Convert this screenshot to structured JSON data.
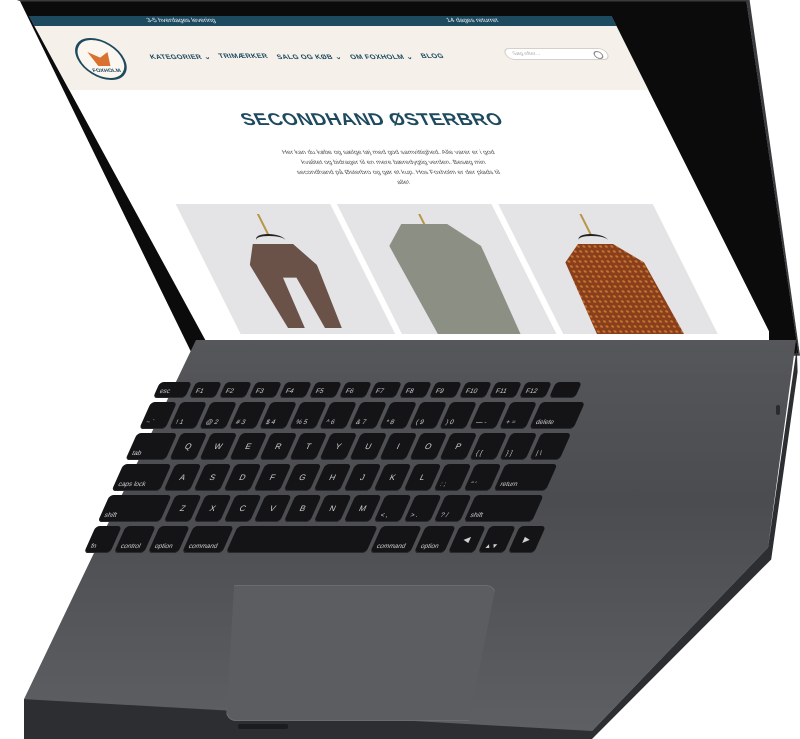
{
  "screen": {
    "topbar": {
      "left": "3-5 hverdages levering",
      "right": "14 dages returret"
    },
    "logo_text": "FOXHOLM",
    "nav": [
      "KATEGORIER ⌄",
      "TRIMÆRKER",
      "SALG OG KØB ⌄",
      "OM FOXHOLM ⌄",
      "BLOG"
    ],
    "search_placeholder": "Søg efter...",
    "title": "SECONDHAND ØSTERBRO",
    "intro": "Her kan du købe og sælge tøj med god samvittighed. Alle varer er i god kvalitet og bidrager til en mere bæredygtig verden. Besøg min secondhand på Østerbro og gør et kup. Hos Foxholm er der plads til alle!",
    "products": [
      "brown-cardigan",
      "grey-fur-coat",
      "patterned-dress"
    ]
  },
  "keyboard": {
    "fn_row": [
      "esc",
      "F1",
      "F2",
      "F3",
      "F4",
      "F5",
      "F6",
      "F7",
      "F8",
      "F9",
      "F10",
      "F11",
      "F12",
      ""
    ],
    "row1": [
      "~\n`",
      "!\n1",
      "@\n2",
      "#\n3",
      "$\n4",
      "%\n5",
      "^\n6",
      "&\n7",
      "*\n8",
      "(\n9",
      ")\n0",
      "—\n-",
      "+\n=",
      "delete"
    ],
    "row2": [
      "tab",
      "Q",
      "W",
      "E",
      "R",
      "T",
      "Y",
      "U",
      "I",
      "O",
      "P",
      "{\n[",
      "}\n]",
      "|\n\\"
    ],
    "row3": [
      "caps lock",
      "A",
      "S",
      "D",
      "F",
      "G",
      "H",
      "J",
      "K",
      "L",
      ":\n;",
      "\"\n'",
      "return"
    ],
    "row4": [
      "shift",
      "Z",
      "X",
      "C",
      "V",
      "B",
      "N",
      "M",
      "<\n,",
      ">\n.",
      "?\n/",
      "shift"
    ],
    "row5": [
      "fn",
      "control",
      "option",
      "command",
      "",
      "command",
      "option",
      "◀",
      "▲▼",
      "▶"
    ]
  }
}
